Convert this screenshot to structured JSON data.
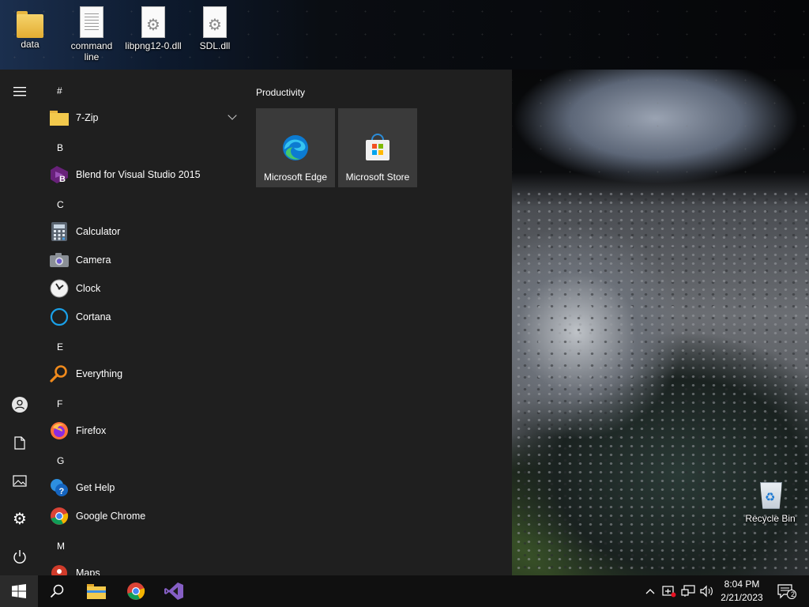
{
  "desktop": {
    "icons": [
      {
        "label": "data",
        "icon": "folder-icon"
      },
      {
        "label": "command line",
        "icon": "text-document-icon"
      },
      {
        "label": "libpng12-0.dll",
        "icon": "dll-file-icon"
      },
      {
        "label": "SDL.dll",
        "icon": "dll-file-icon"
      },
      {
        "label": "Recycle Bin",
        "icon": "recycle-bin-icon"
      }
    ]
  },
  "start_menu": {
    "sections": [
      {
        "letter": "#",
        "apps": [
          {
            "name": "7-Zip",
            "icon": "folder-icon",
            "expandable": true
          }
        ]
      },
      {
        "letter": "B",
        "apps": [
          {
            "name": "Blend for Visual Studio 2015",
            "icon": "blend-icon"
          }
        ]
      },
      {
        "letter": "C",
        "apps": [
          {
            "name": "Calculator",
            "icon": "calculator-icon"
          },
          {
            "name": "Camera",
            "icon": "camera-icon"
          },
          {
            "name": "Clock",
            "icon": "clock-icon"
          },
          {
            "name": "Cortana",
            "icon": "cortana-icon"
          }
        ]
      },
      {
        "letter": "E",
        "apps": [
          {
            "name": "Everything",
            "icon": "search-magnifier-icon"
          }
        ]
      },
      {
        "letter": "F",
        "apps": [
          {
            "name": "Firefox",
            "icon": "firefox-icon"
          }
        ]
      },
      {
        "letter": "G",
        "apps": [
          {
            "name": "Get Help",
            "icon": "get-help-icon"
          },
          {
            "name": "Google Chrome",
            "icon": "chrome-icon"
          }
        ]
      },
      {
        "letter": "M",
        "apps": [
          {
            "name": "Maps",
            "icon": "maps-icon"
          }
        ]
      }
    ],
    "tile_group": {
      "title": "Productivity",
      "tiles": [
        {
          "label": "Microsoft Edge",
          "icon": "edge-icon"
        },
        {
          "label": "Microsoft Store",
          "icon": "store-icon"
        }
      ]
    },
    "rail": [
      "hamburger-menu-icon",
      "user-account-icon",
      "documents-icon",
      "pictures-icon",
      "settings-icon",
      "power-icon"
    ]
  },
  "taskbar": {
    "pinned": [
      "windows-start-icon",
      "search-icon",
      "file-explorer-icon",
      "chrome-icon",
      "visual-studio-icon"
    ],
    "clock": {
      "time": "8:04 PM",
      "date": "2/21/2023"
    },
    "notification_count": "2"
  },
  "colors": {
    "start_bg": "#1f1f1f",
    "tile_bg": "#3a3a3a",
    "taskbar_bg": "#101010",
    "accent_blue": "#0078d7"
  }
}
